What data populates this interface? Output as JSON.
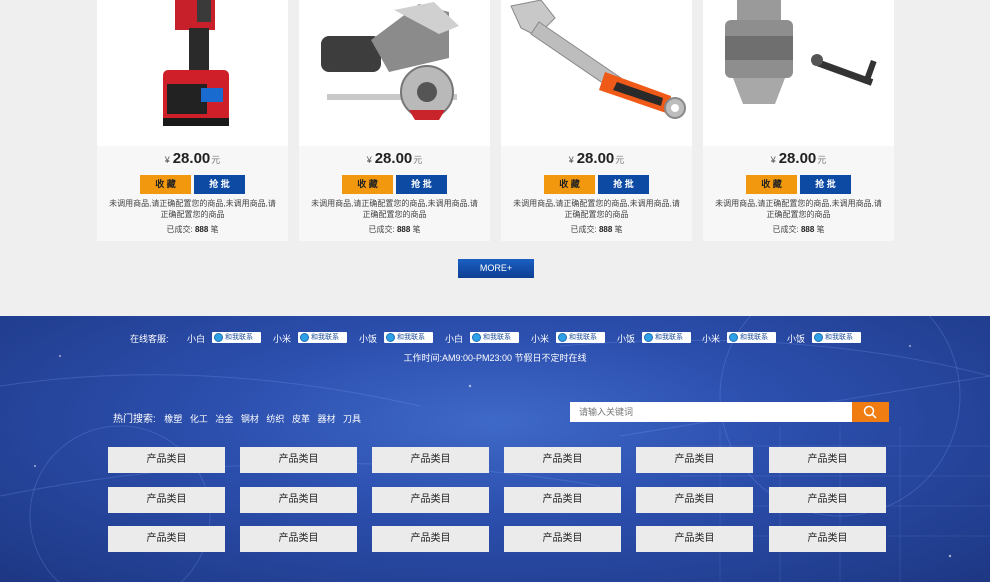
{
  "products": [
    {
      "currency": "¥",
      "price": "28.00",
      "unit": "元",
      "fav_label": "收 藏",
      "buy_label": "抢 批",
      "desc": "未调用商品,请正确配置您的商品,未调用商品,请正确配置您的商品",
      "sold_label": "已成交:",
      "sold_count": "888",
      "sold_unit": "笔",
      "image": "cordless-drill"
    },
    {
      "currency": "¥",
      "price": "28.00",
      "unit": "元",
      "fav_label": "收 藏",
      "buy_label": "抢 批",
      "desc": "未调用商品,请正确配置您的商品,未调用商品,请正确配置您的商品",
      "sold_label": "已成交:",
      "sold_count": "888",
      "sold_unit": "笔",
      "image": "circular-saw"
    },
    {
      "currency": "¥",
      "price": "28.00",
      "unit": "元",
      "fav_label": "收 藏",
      "buy_label": "抢 批",
      "desc": "未调用商品,请正确配置您的商品,未调用商品,请正确配置您的商品",
      "sold_label": "已成交:",
      "sold_count": "888",
      "sold_unit": "笔",
      "image": "adjustable-wrench"
    },
    {
      "currency": "¥",
      "price": "28.00",
      "unit": "元",
      "fav_label": "收 藏",
      "buy_label": "抢 批",
      "desc": "未调用商品,请正确配置您的商品,未调用商品,请正确配置您的商品",
      "sold_label": "已成交:",
      "sold_count": "888",
      "sold_unit": "笔",
      "image": "drill-chuck-and-key"
    }
  ],
  "more_label": "MORE+",
  "service": {
    "label": "在线客服:",
    "agents": [
      "小白",
      "小米",
      "小饭",
      "小白",
      "小米",
      "小饭",
      "小米",
      "小饭"
    ],
    "contact_label": "和我联系",
    "hours": "工作时间:AM9:00-PM23:00 节假日不定时在线"
  },
  "hot_search": {
    "label": "热门搜索:",
    "keywords": [
      "橡塑",
      "化工",
      "冶金",
      "钢材",
      "纺织",
      "皮革",
      "器材",
      "刀具"
    ]
  },
  "search": {
    "placeholder": "请输入关键词",
    "icon": "search-icon"
  },
  "categories": [
    "产品类目",
    "产品类目",
    "产品类目",
    "产品类目",
    "产品类目",
    "产品类目",
    "产品类目",
    "产品类目",
    "产品类目",
    "产品类目",
    "产品类目",
    "产品类目",
    "产品类目",
    "产品类目",
    "产品类目",
    "产品类目",
    "产品类目",
    "产品类目"
  ],
  "colors": {
    "fav_button": "#f2980e",
    "buy_button": "#0d4aa4",
    "search_button": "#f07d12",
    "footer_bg": "#2c4fae"
  }
}
